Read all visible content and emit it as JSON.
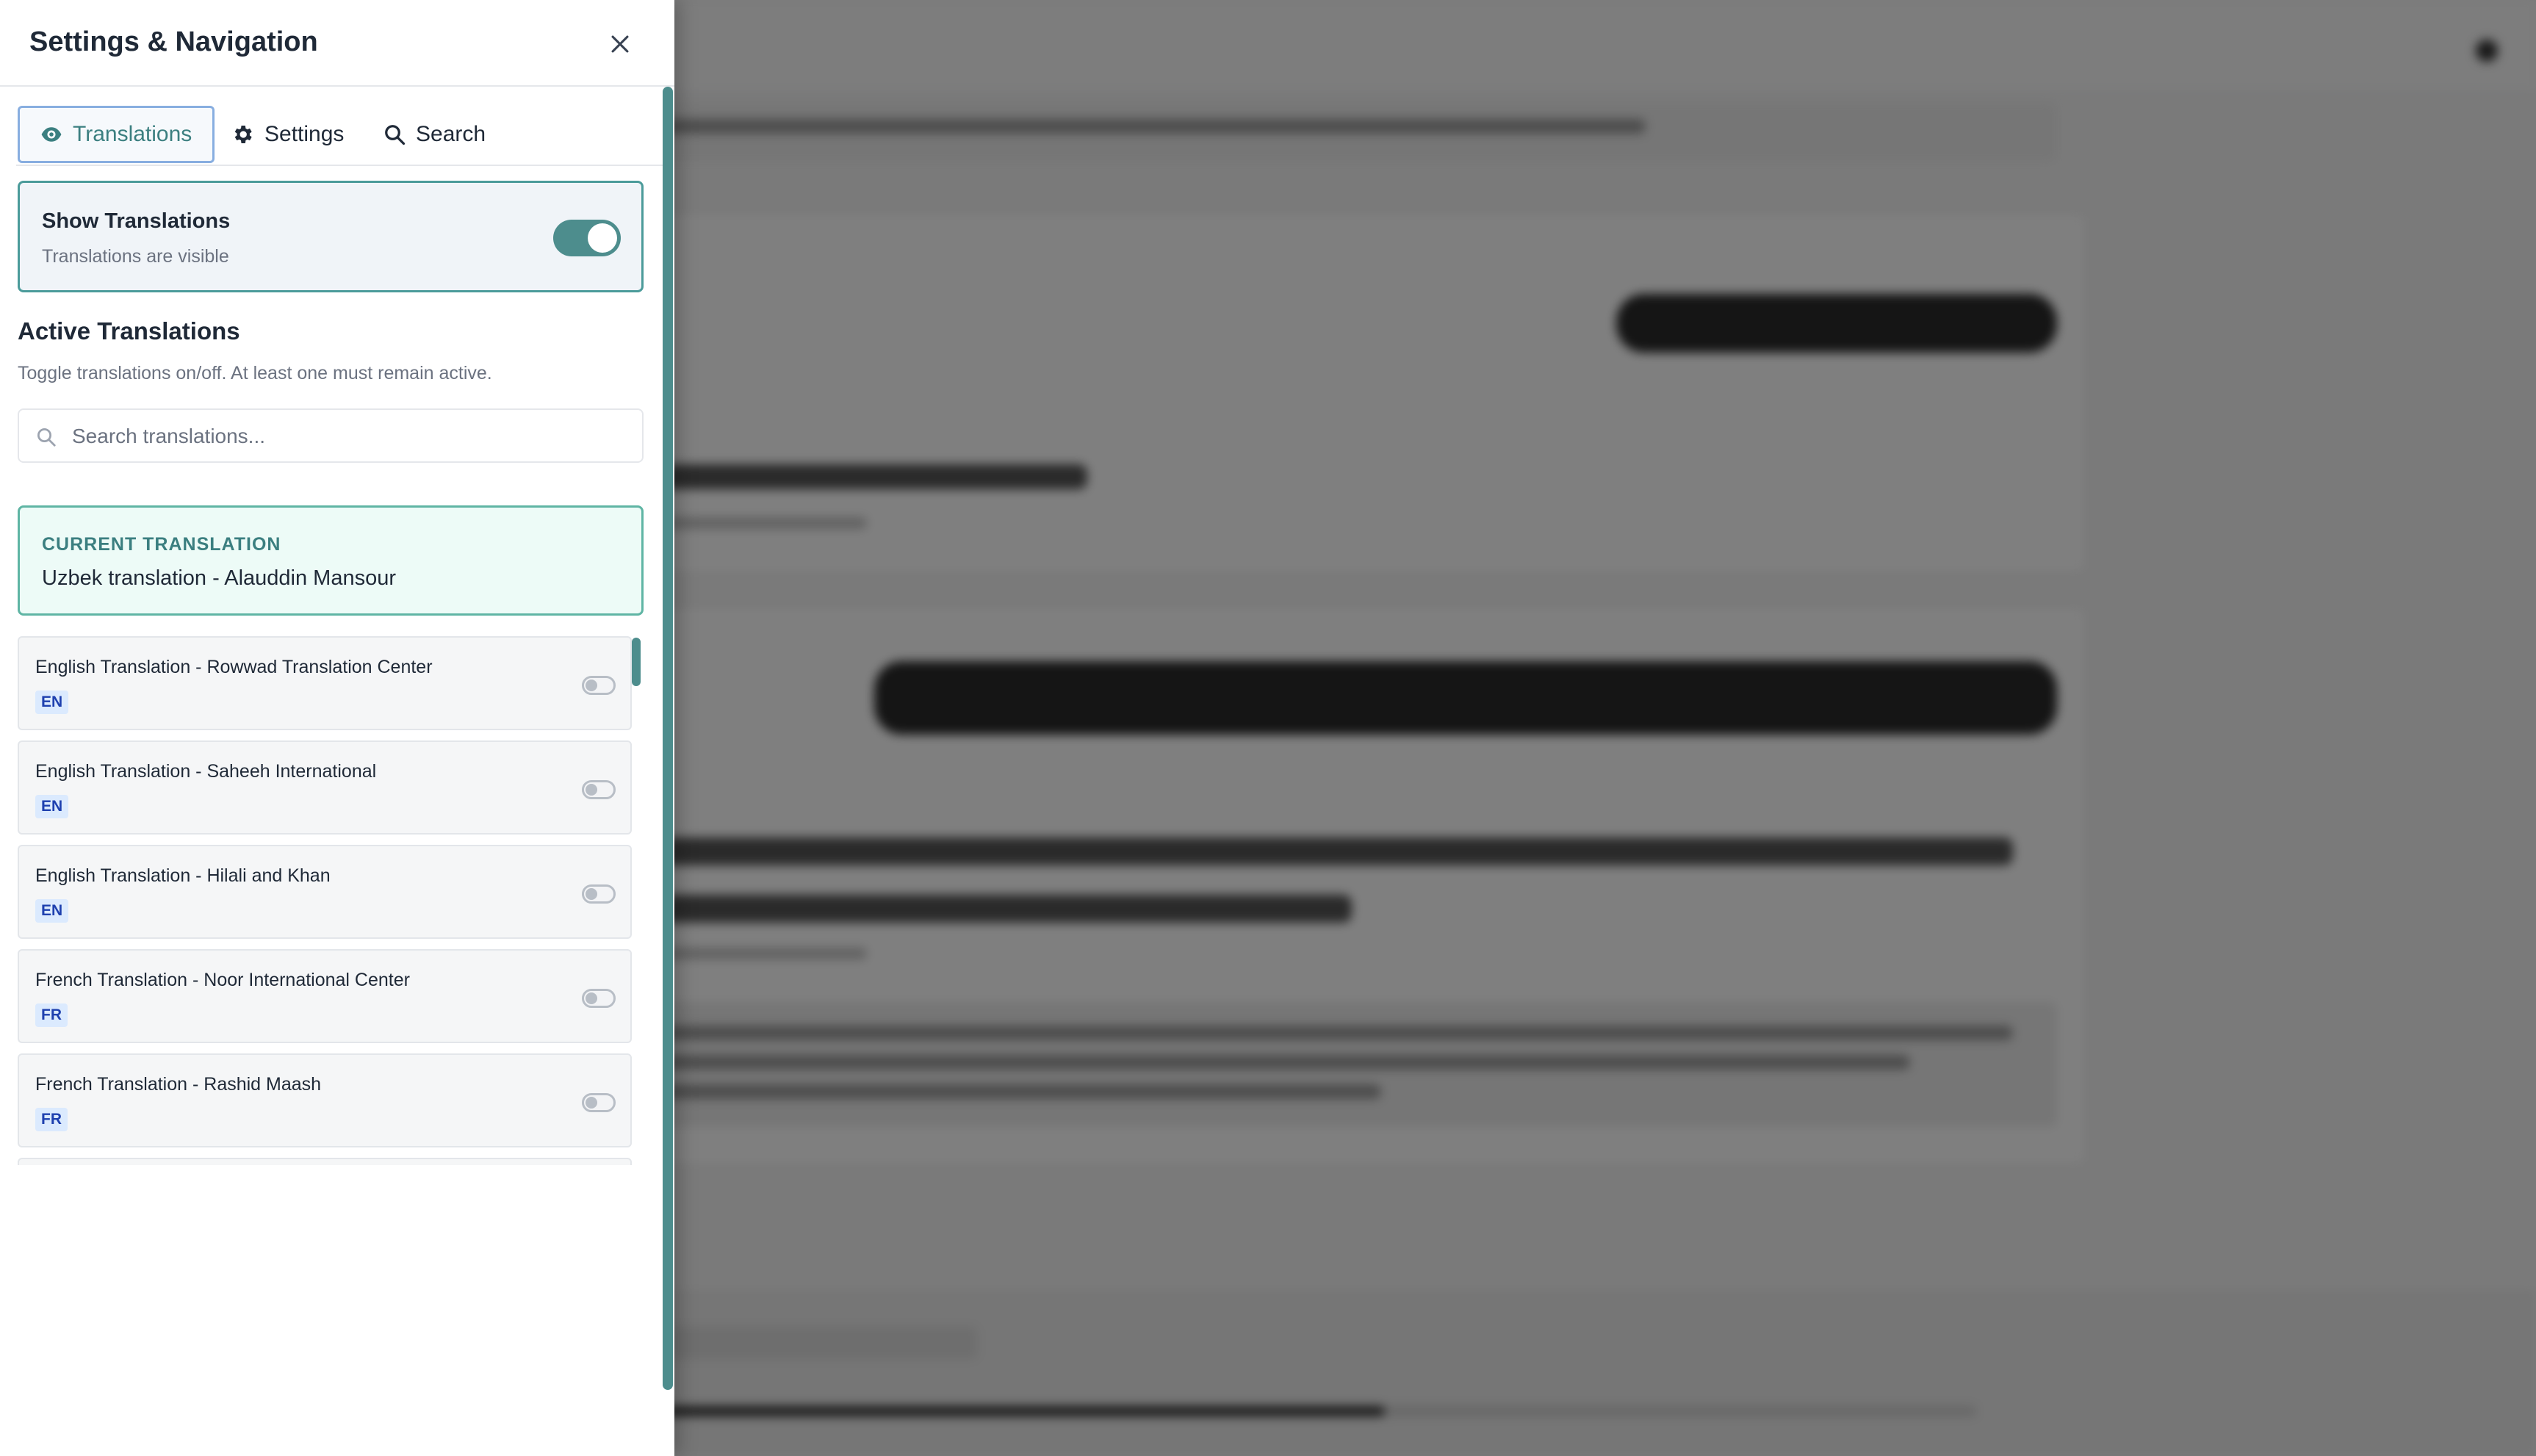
{
  "drawer": {
    "title": "Settings & Navigation",
    "close_icon": "close-icon",
    "tabs": [
      {
        "label": "Translations",
        "icon": "eye-icon",
        "active": true
      },
      {
        "label": "Settings",
        "icon": "gear-icon",
        "active": false
      },
      {
        "label": "Search",
        "icon": "search-icon",
        "active": false
      }
    ],
    "show_translations": {
      "title": "Show Translations",
      "subtitle": "Translations are visible",
      "enabled": true
    },
    "active_translations": {
      "title": "Active Translations",
      "description": "Toggle translations on/off. At least one must remain active.",
      "search_placeholder": "Search translations..."
    },
    "current": {
      "label": "CURRENT TRANSLATION",
      "name": "Uzbek translation - Alauddin Mansour"
    },
    "translations": [
      {
        "name": "English Translation - Rowwad Translation Center",
        "lang": "EN",
        "enabled": false
      },
      {
        "name": "English Translation - Saheeh International",
        "lang": "EN",
        "enabled": false
      },
      {
        "name": "English Translation - Hilali and Khan",
        "lang": "EN",
        "enabled": false
      },
      {
        "name": "French Translation - Noor International Center",
        "lang": "FR",
        "enabled": false
      },
      {
        "name": "French Translation - Rashid Maash",
        "lang": "FR",
        "enabled": false
      }
    ]
  },
  "colors": {
    "accent": "#4d8d8d",
    "accent_text": "#3b7f80",
    "current_bg": "#edfbf7",
    "badge_bg": "#dbeafe",
    "badge_text": "#1e40af"
  }
}
